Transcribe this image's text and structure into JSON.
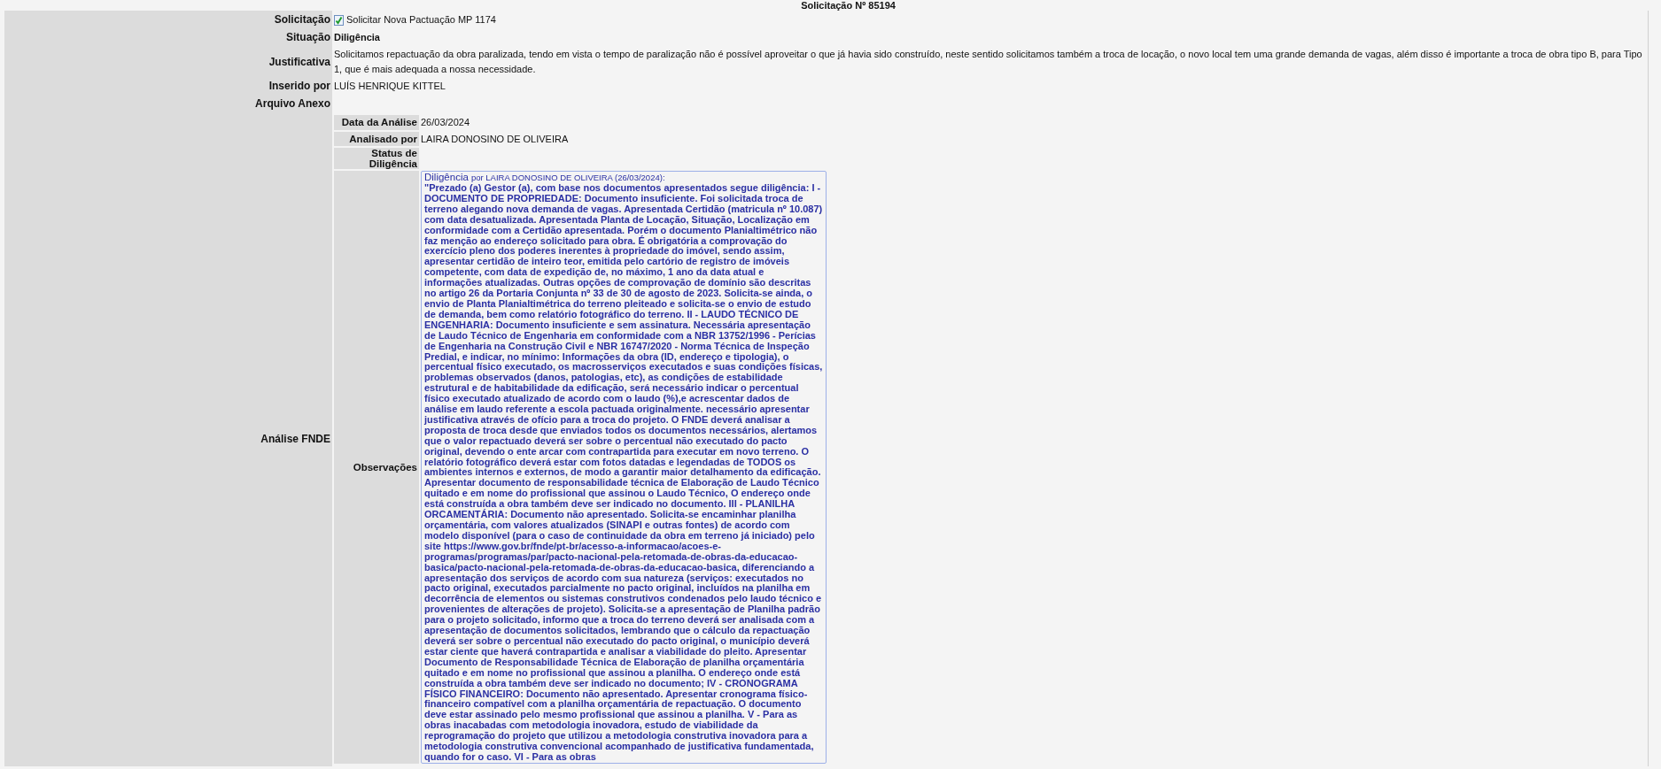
{
  "header": {
    "title": "Solicitação Nº 85194"
  },
  "fields": [
    {
      "label": "Solicitação",
      "value": "Solicitar Nova Pactuação MP 1174",
      "kind": "checked-item"
    },
    {
      "label": "Situação",
      "value": "Diligência",
      "kind": "bold"
    },
    {
      "label": "Justificativa",
      "value": "Solicitamos repactuação da obra paralizada, tendo em vista o tempo de paralização não é possível aproveitar o que já havia sido construído, neste sentido solicitamos também a troca de locação, o novo local tem uma grande demanda de vagas, além disso é importante a troca de obra tipo B, para Tipo 1, que é mais adequada a nossa necessidade.",
      "kind": "text"
    },
    {
      "label": "Inserido por",
      "value": "LUÍS HENRIQUE KITTEL",
      "kind": "text"
    },
    {
      "label": "Arquivo Anexo"
    }
  ],
  "analysis": {
    "label": "Análise FNDE",
    "fields": [
      {
        "label": "Data da Análise",
        "value": "26/03/2024"
      },
      {
        "label": "Analisado por",
        "value": "LAIRA DONOSINO DE OLIVEIRA"
      },
      {
        "label": "Status de Diligência"
      },
      {
        "label": "Observações",
        "note": {
          "title": "Diligência",
          "byline": "por LAIRA DONOSINO DE OLIVEIRA (26/03/2024):",
          "body": "\"Prezado (a) Gestor (a), com base nos documentos apresentados segue diligência: I - DOCUMENTO DE PROPRIEDADE: Documento insuficiente. Foi solicitada troca de terreno alegando nova demanda de vagas. Apresentada Certidão (matricula nº 10.087) com data desatualizada. Apresentada Planta de Locação, Situação, Localização em conformidade com a Certidão apresentada. Porém o documento Planialtimétrico não faz menção ao endereço solicitado para obra. É obrigatória a comprovação do exercício pleno dos poderes inerentes à propriedade do imóvel, sendo assim, apresentar certidão de inteiro teor, emitida pelo cartório de registro de imóveis competente, com data de expedição de, no máximo, 1 ano da data atual e informações atualizadas. Outras opções de comprovação de domínio são descritas no artigo 26 da Portaria Conjunta nº 33 de 30 de agosto de 2023. Solicita-se ainda, o envio de Planta Planialtimétrica do terreno pleiteado e solicita-se o envio de estudo de demanda, bem como relatório fotográfico do terreno. II - LAUDO TÉCNICO DE ENGENHARIA: Documento insuficiente e sem assinatura. Necessária apresentação de Laudo Técnico de Engenharia em conformidade com a NBR 13752/1996 - Perícias de Engenharia na Construção Civil e NBR 16747/2020 - Norma Técnica de Inspeção Predial, e indicar, no mínimo: Informações da obra (ID, endereço e tipologia), o percentual físico executado, os macrosserviços executados e suas condições físicas, problemas observados (danos, patologias, etc), as condições de estabilidade estrutural e de habitabilidade da edificação, será necessário indicar o percentual físico executado atualizado de acordo com o laudo (%),e acrescentar dados de análise em laudo referente a escola pactuada originalmente. necessário apresentar justificativa através de ofício para a troca do projeto. O FNDE deverá analisar a proposta de troca desde que enviados todos os documentos necessários, alertamos que o valor repactuado deverá ser sobre o percentual não executado do pacto original, devendo o ente arcar com contrapartida para executar em novo terreno. O relatório fotográfico deverá estar com fotos datadas e legendadas de TODOS os ambientes internos e externos, de modo a garantir maior detalhamento da edificação. Apresentar documento de responsabilidade técnica de Elaboração de Laudo Técnico quitado e em nome do profissional que assinou o Laudo Técnico, O endereço onde está construída a obra também deve ser indicado no documento. III - PLANILHA ORCAMENTÁRIA: Documento não apresentado. Solicita-se encaminhar planilha orçamentária, com valores atualizados (SINAPI e outras fontes) de acordo com modelo disponível (para o caso de continuidade da obra em terreno já iniciado) pelo site https://www.gov.br/fnde/pt-br/acesso-a-informacao/acoes-e-programas/programas/par/pacto-nacional-pela-retomada-de-obras-da-educacao-basica/pacto-nacional-pela-retomada-de-obras-da-educacao-basica, diferenciando a apresentação dos serviços de acordo com sua natureza (serviços: executados no pacto original, executados parcialmente no pacto original, incluídos na planilha em decorrência de elementos ou sistemas construtivos condenados pelo laudo técnico e provenientes de alterações de projeto). Solicita-se a apresentação de Planilha padrão para o projeto solicitado, informo que a troca do terreno deverá ser analisada com a apresentação de documentos solicitados, lembrando que o cálculo da repactuação deverá ser sobre o percentual não executado do pacto original, o município deverá estar ciente que haverá contrapartida e analisar a viabilidade do pleito. Apresentar Documento de Responsabilidade Técnica de Elaboração de planilha orçamentária quitado e em nome no profissional que assinou a planilha. O endereço onde está construída a obra também deve ser indicado no documento; IV - CRONOGRAMA FÍSICO FINANCEIRO: Documento não apresentado. Apresentar cronograma físico-financeiro compatível com a planilha orçamentária de repactuação. O documento deve estar assinado pelo mesmo profissional que assinou a planilha. V - Para as obras inacabadas com metodologia inovadora, estudo de viabilidade da reprogramação do projeto que utilizou a metodologia construtiva inovadora para a metodologia construtiva convencional acompanhado de justificativa fundamentada, quando for o caso. VI - Para as obras"
        }
      }
    ]
  }
}
